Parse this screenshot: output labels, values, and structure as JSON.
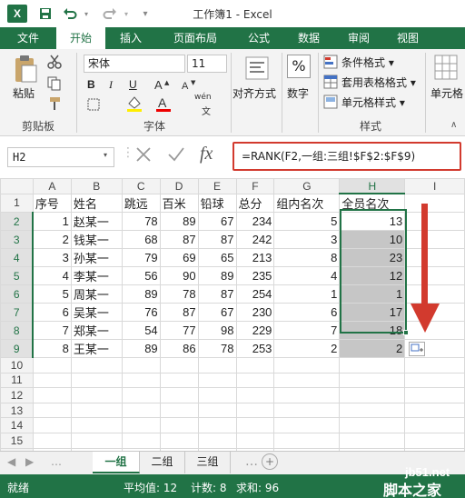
{
  "window": {
    "title": "工作簿1 - Excel"
  },
  "tabs": [
    {
      "label": "文件",
      "active": false
    },
    {
      "label": "开始",
      "active": true
    },
    {
      "label": "插入",
      "active": false
    },
    {
      "label": "页面布局",
      "active": false
    },
    {
      "label": "公式",
      "active": false
    },
    {
      "label": "数据",
      "active": false
    },
    {
      "label": "审阅",
      "active": false
    },
    {
      "label": "视图",
      "active": false
    }
  ],
  "ribbon": {
    "paste_label": "粘贴",
    "clipboard_label": "剪贴板",
    "font_name": "宋体",
    "font_size": "11",
    "font_label": "字体",
    "align_label": "对齐方式",
    "number_label": "数字",
    "percent_symbol": "%",
    "cond_format": "条件格式",
    "table_format": "套用表格格式",
    "cell_style": "单元格样式",
    "styles_label": "样式",
    "cells_label": "单元格",
    "bold": "B",
    "italic": "I",
    "underline": "U",
    "wen_label": "wén",
    "font_a": "A"
  },
  "formula_bar": {
    "name_box": "H2",
    "formula": "=RANK(F2,一组:三组!$F$2:$F$9)",
    "fx": "fx"
  },
  "sheet": {
    "columns": [
      "A",
      "B",
      "C",
      "D",
      "E",
      "F",
      "G",
      "H",
      "I"
    ],
    "selected_column": "H",
    "header_row": [
      "序号",
      "姓名",
      "跳远",
      "百米",
      "铅球",
      "总分",
      "组内名次",
      "全员名次",
      ""
    ],
    "rows": [
      [
        "1",
        "赵某一",
        "78",
        "89",
        "67",
        "234",
        "5",
        "13",
        ""
      ],
      [
        "2",
        "钱某一",
        "68",
        "87",
        "87",
        "242",
        "3",
        "10",
        ""
      ],
      [
        "3",
        "孙某一",
        "79",
        "69",
        "65",
        "213",
        "8",
        "23",
        ""
      ],
      [
        "4",
        "李某一",
        "56",
        "90",
        "89",
        "235",
        "4",
        "12",
        ""
      ],
      [
        "5",
        "周某一",
        "89",
        "78",
        "87",
        "254",
        "1",
        "1",
        ""
      ],
      [
        "6",
        "吴某一",
        "76",
        "87",
        "67",
        "230",
        "6",
        "17",
        ""
      ],
      [
        "7",
        "郑某一",
        "54",
        "77",
        "98",
        "229",
        "7",
        "18",
        ""
      ],
      [
        "8",
        "王某一",
        "89",
        "86",
        "78",
        "253",
        "2",
        "2",
        ""
      ]
    ],
    "row_numbers": [
      "1",
      "2",
      "3",
      "4",
      "5",
      "6",
      "7",
      "8",
      "9",
      "10",
      "11",
      "12",
      "13",
      "14",
      "15",
      "16"
    ]
  },
  "sheet_tabs": [
    {
      "label": "一组",
      "active": true
    },
    {
      "label": "二组",
      "active": false
    },
    {
      "label": "三组",
      "active": false
    }
  ],
  "status": {
    "ready": "就绪",
    "average": "平均值: 12",
    "count": "计数: 8",
    "sum": "求和: 96"
  },
  "watermark": {
    "site": "jb51.net",
    "name": "脚本之家"
  },
  "colors": {
    "accent": "#217346",
    "annotation": "#d23a2e"
  }
}
